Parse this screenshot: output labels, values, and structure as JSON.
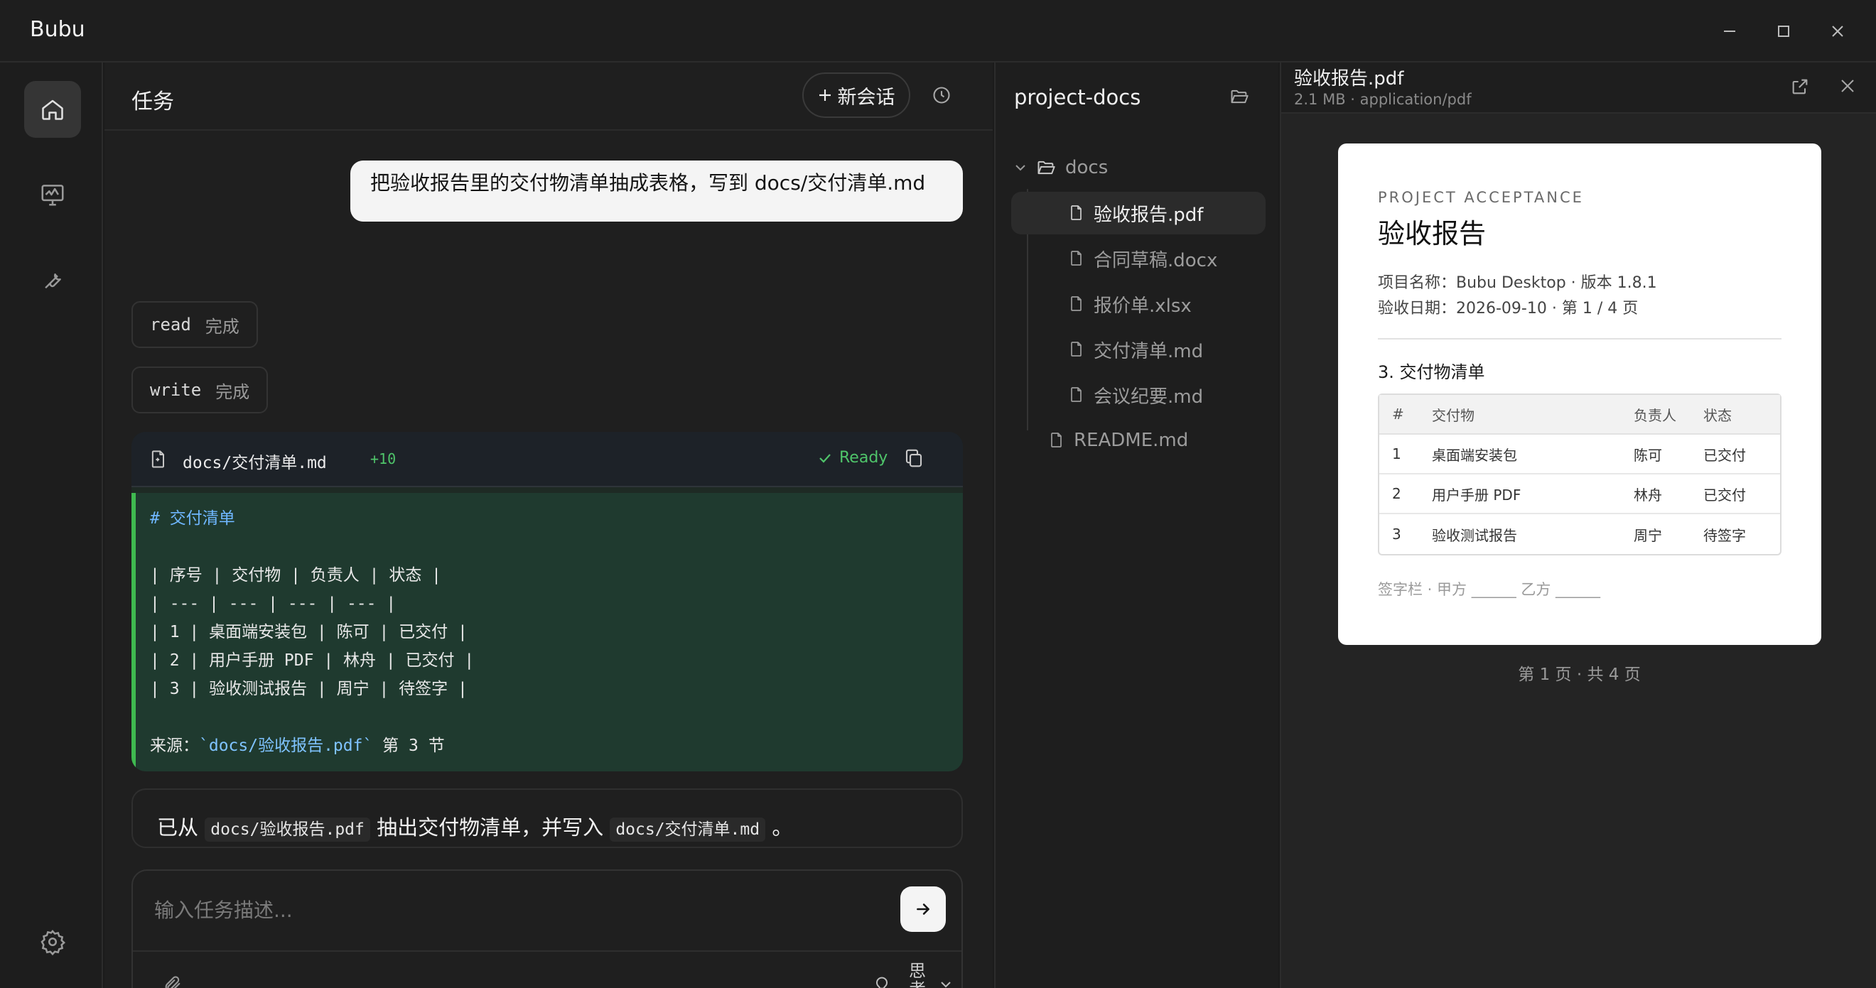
{
  "window": {
    "title": "Bubu"
  },
  "task": {
    "title": "任务",
    "new_chat_label": "新会话",
    "user_message": "把验收报告里的交付物清单抽成表格，写到 docs/交付清单.md",
    "tool_calls": [
      {
        "tool": "read",
        "status": "完成"
      },
      {
        "tool": "write",
        "status": "完成"
      }
    ],
    "diff": {
      "file": "docs/交付清单.md",
      "count": "+10",
      "status": "Ready",
      "lines": [
        "# 交付清单",
        "",
        "| 序号 | 交付物 | 负责人 | 状态 |",
        "| --- | --- | --- | --- |",
        "| 1 | 桌面端安装包 | 陈可 | 已交付 |",
        "| 2 | 用户手册 PDF | 林舟 | 已交付 |",
        "| 3 | 验收测试报告 | 周宁 | 待签字 |",
        "",
        "来源：`docs/验收报告.pdf` 第 3 节"
      ]
    },
    "reply": {
      "prefix": "已从",
      "source": "docs/验收报告.pdf",
      "middle": "抽出交付物清单，并写入",
      "target": "docs/交付清单.md",
      "suffix": "。"
    },
    "input_placeholder": "输入任务描述...",
    "think_label": "思考"
  },
  "tree": {
    "title": "project-docs",
    "folder": "docs",
    "files": [
      "验收报告.pdf",
      "合同草稿.docx",
      "报价单.xlsx",
      "交付清单.md",
      "会议纪要.md"
    ],
    "selected": "验收报告.pdf",
    "root_files": [
      "README.md"
    ]
  },
  "preview": {
    "file_name": "验收报告.pdf",
    "file_meta": "2.1 MB · application/pdf",
    "page": {
      "kicker": "PROJECT ACCEPTANCE",
      "title": "验收报告",
      "project_line": "项目名称：Bubu Desktop · 版本 1.8.1",
      "date_line": "验收日期：2026-09-10 · 第 1 / 4 页",
      "section": "3. 交付物清单",
      "table_headers": [
        "#",
        "交付物",
        "负责人",
        "状态"
      ],
      "table_rows": [
        [
          "1",
          "桌面端安装包",
          "陈可",
          "已交付"
        ],
        [
          "2",
          "用户手册 PDF",
          "林舟",
          "已交付"
        ],
        [
          "3",
          "验收测试报告",
          "周宁",
          "待签字"
        ]
      ],
      "sign_line": "签字栏 · 甲方 ______   乙方 ______"
    },
    "page_indicator": "第 1 页 · 共 4 页"
  },
  "colors": {
    "accent_green": "#3fb950",
    "page_bg": "#ffffff",
    "app_bg": "#1b1b1b"
  }
}
